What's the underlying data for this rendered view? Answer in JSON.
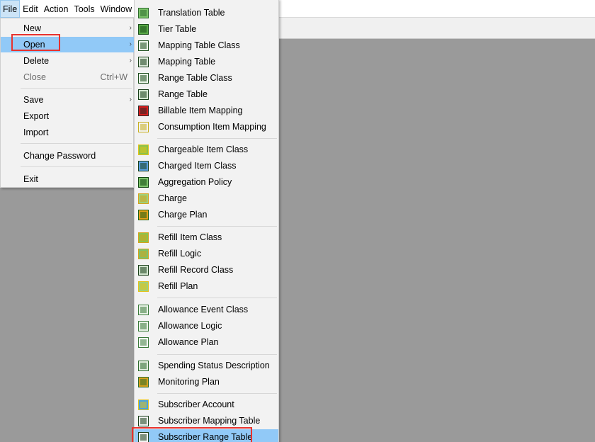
{
  "menubar": {
    "items": [
      "File",
      "Edit",
      "Action",
      "Tools",
      "Window"
    ]
  },
  "file_menu": {
    "new": "New",
    "open": "Open",
    "delete": "Delete",
    "close": "Close",
    "close_shortcut": "Ctrl+W",
    "save": "Save",
    "export": "Export",
    "import": "Import",
    "change_password": "Change Password",
    "exit": "Exit"
  },
  "open_submenu": {
    "items": [
      "Translation Table",
      "Tier Table",
      "Mapping Table Class",
      "Mapping Table",
      "Range Table Class",
      "Range Table",
      "Billable Item Mapping",
      "Consumption Item Mapping",
      "Chargeable Item Class",
      "Charged Item Class",
      "Aggregation Policy",
      "Charge",
      "Charge Plan",
      "Refill Item Class",
      "Refill Logic",
      "Refill Record Class",
      "Refill Plan",
      "Allowance Event Class",
      "Allowance Logic",
      "Allowance Plan",
      "Spending Status Description",
      "Monitoring Plan",
      "Subscriber Account",
      "Subscriber Mapping Table",
      "Subscriber Range Table"
    ],
    "icons": [
      "translation-table-icon",
      "tier-table-icon",
      "mapping-table-class-icon",
      "mapping-table-icon",
      "range-table-class-icon",
      "range-table-icon",
      "billable-item-mapping-icon",
      "consumption-item-mapping-icon",
      "chargeable-item-class-icon",
      "charged-item-class-icon",
      "aggregation-policy-icon",
      "charge-icon",
      "charge-plan-icon",
      "refill-item-class-icon",
      "refill-logic-icon",
      "refill-record-class-icon",
      "refill-plan-icon",
      "allowance-event-class-icon",
      "allowance-logic-icon",
      "allowance-plan-icon",
      "spending-status-description-icon",
      "monitoring-plan-icon",
      "subscriber-account-icon",
      "subscriber-mapping-table-icon",
      "subscriber-range-table-icon"
    ]
  },
  "colors": {
    "highlight": "#91c9f7",
    "annotation_box": "#e8332f",
    "workspace": "#9a9a9a"
  }
}
